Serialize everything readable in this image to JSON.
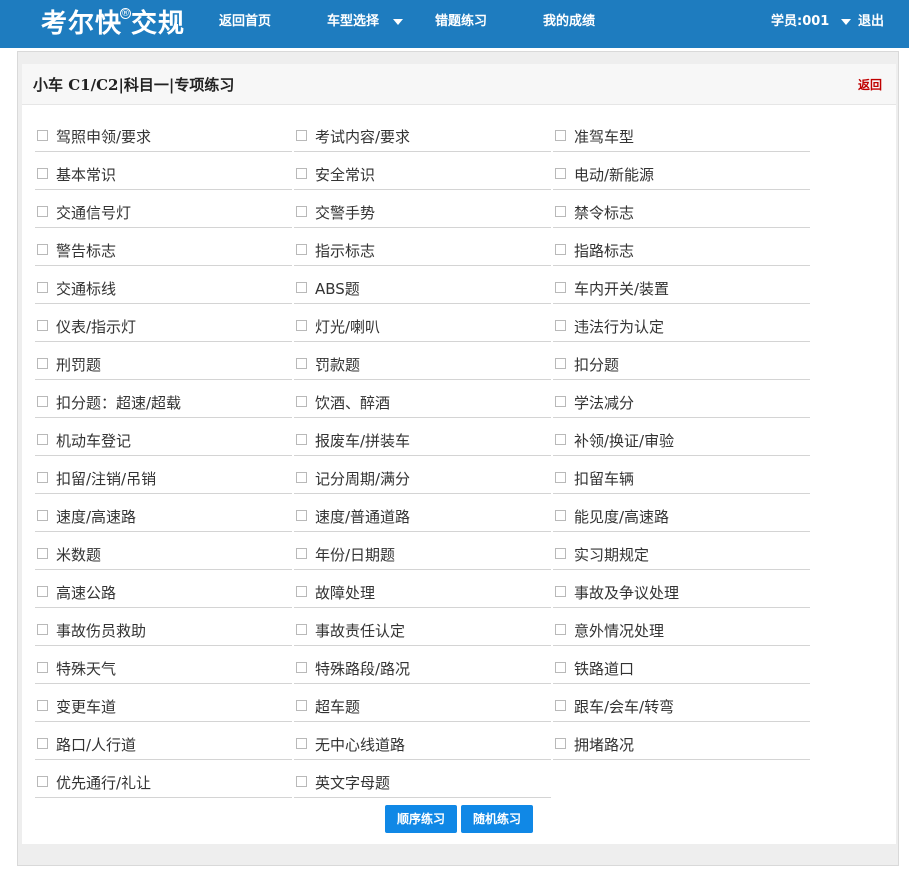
{
  "header": {
    "logo_text": "考尔快",
    "logo_text2": "交规",
    "logo_reg": "®",
    "nav": {
      "home": "返回首页",
      "car_select": "车型选择",
      "wrong_practice": "错题练习",
      "my_scores": "我的成绩"
    },
    "user_label": "学员:001",
    "logout": "退出"
  },
  "panel": {
    "title": "小车 C1/C2|科目一|专项练习",
    "back": "返回"
  },
  "topics": [
    [
      "驾照申领/要求",
      "考试内容/要求",
      "准驾车型"
    ],
    [
      "基本常识",
      "安全常识",
      "电动/新能源"
    ],
    [
      "交通信号灯",
      "交警手势",
      "禁令标志"
    ],
    [
      "警告标志",
      "指示标志",
      "指路标志"
    ],
    [
      "交通标线",
      "ABS题",
      "车内开关/装置"
    ],
    [
      "仪表/指示灯",
      "灯光/喇叭",
      "违法行为认定"
    ],
    [
      "刑罚题",
      "罚款题",
      "扣分题"
    ],
    [
      "扣分题：超速/超载",
      "饮酒、醉酒",
      "学法减分"
    ],
    [
      "机动车登记",
      "报废车/拼装车",
      "补领/换证/审验"
    ],
    [
      "扣留/注销/吊销",
      "记分周期/满分",
      "扣留车辆"
    ],
    [
      "速度/高速路",
      "速度/普通道路",
      "能见度/高速路"
    ],
    [
      "米数题",
      "年份/日期题",
      "实习期规定"
    ],
    [
      "高速公路",
      "故障处理",
      "事故及争议处理"
    ],
    [
      "事故伤员救助",
      "事故责任认定",
      "意外情况处理"
    ],
    [
      "特殊天气",
      "特殊路段/路况",
      "铁路道口"
    ],
    [
      "变更车道",
      "超车题",
      "跟车/会车/转弯"
    ],
    [
      "路口/人行道",
      "无中心线道路",
      "拥堵路况"
    ],
    [
      "优先通行/礼让",
      "英文字母题"
    ]
  ],
  "buttons": {
    "sequential": "顺序练习",
    "random": "随机练习"
  },
  "colors": {
    "header_bg": "#1e7cbf",
    "button_bg": "#1088e6",
    "back_link": "#c00000"
  }
}
